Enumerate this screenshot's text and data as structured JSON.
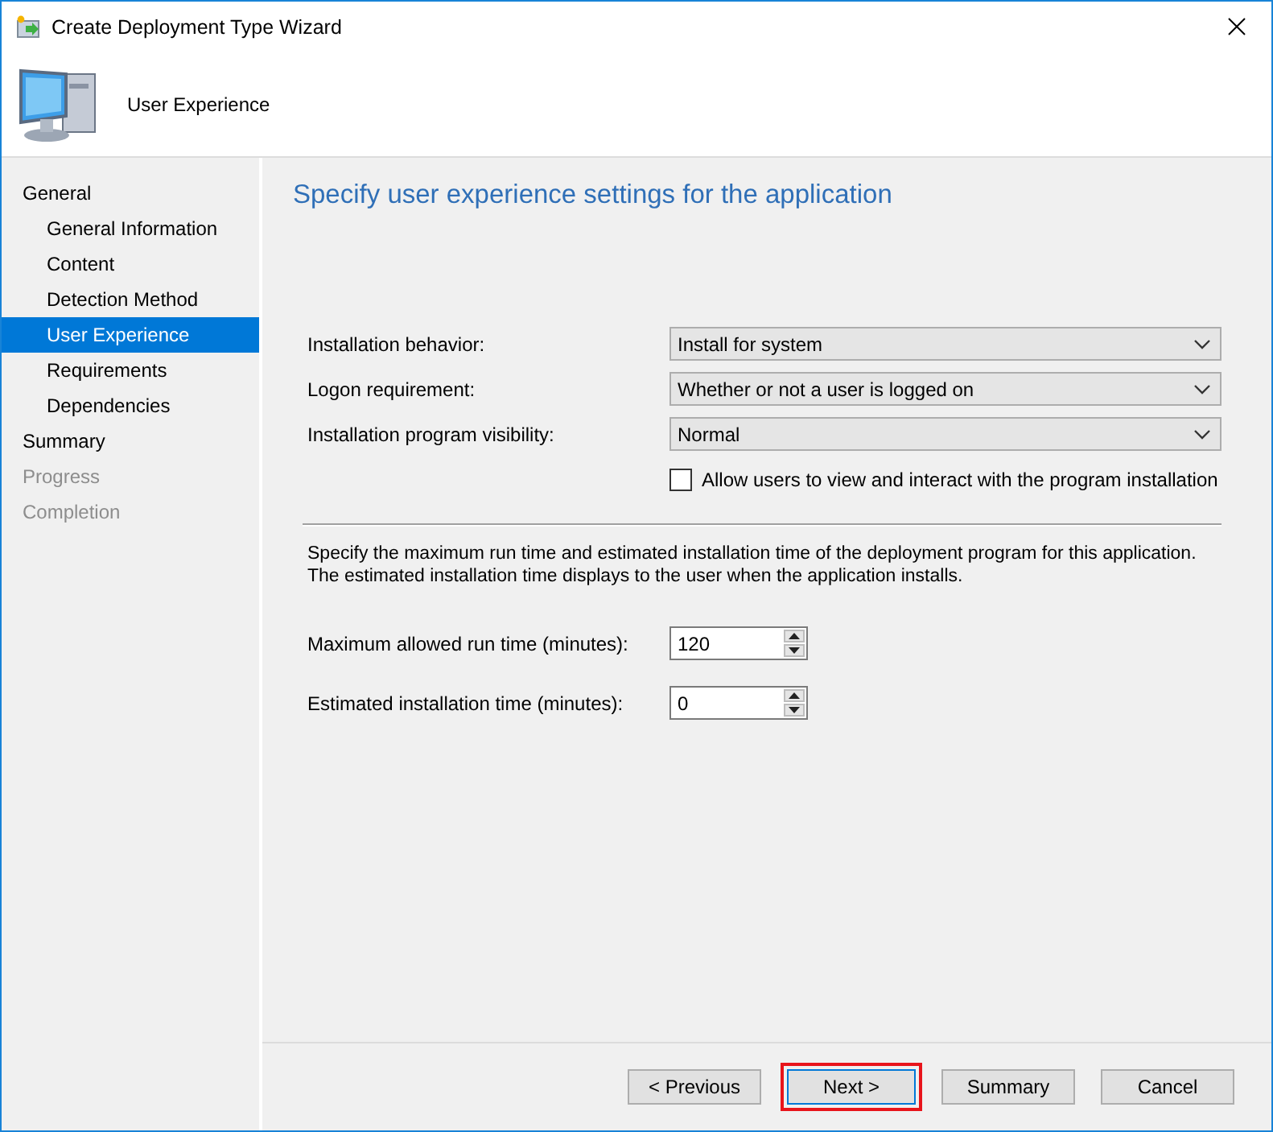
{
  "window": {
    "title": "Create Deployment Type Wizard"
  },
  "header": {
    "title": "User Experience"
  },
  "sidebar": {
    "items": [
      {
        "label": "General",
        "selected": false,
        "disabled": false,
        "children": [
          {
            "label": "General Information",
            "selected": false,
            "disabled": false
          },
          {
            "label": "Content",
            "selected": false,
            "disabled": false
          },
          {
            "label": "Detection Method",
            "selected": false,
            "disabled": false
          },
          {
            "label": "User Experience",
            "selected": true,
            "disabled": false
          },
          {
            "label": "Requirements",
            "selected": false,
            "disabled": false
          },
          {
            "label": "Dependencies",
            "selected": false,
            "disabled": false
          }
        ]
      },
      {
        "label": "Summary",
        "selected": false,
        "disabled": false
      },
      {
        "label": "Progress",
        "selected": false,
        "disabled": true
      },
      {
        "label": "Completion",
        "selected": false,
        "disabled": true
      }
    ]
  },
  "page": {
    "heading": "Specify user experience settings for the application",
    "dropdowns": [
      {
        "label": "Installation behavior:",
        "value": "Install for system"
      },
      {
        "label": "Logon requirement:",
        "value": "Whether or not a user is logged on"
      },
      {
        "label": "Installation program visibility:",
        "value": "Normal"
      }
    ],
    "checkbox": {
      "label": "Allow users to view and interact with the program installation",
      "checked": false
    },
    "description": "Specify the maximum run time and estimated installation time of the deployment program for this application. The estimated installation time displays to the user when the application installs.",
    "spinners": [
      {
        "label": "Maximum allowed run time (minutes):",
        "value": "120"
      },
      {
        "label": "Estimated installation time (minutes):",
        "value": "0"
      }
    ]
  },
  "buttons": [
    {
      "label": "< Previous",
      "highlighted": false
    },
    {
      "label": "Next >",
      "highlighted": true
    },
    {
      "label": "Summary",
      "highlighted": false
    },
    {
      "label": "Cancel",
      "highlighted": false
    }
  ]
}
